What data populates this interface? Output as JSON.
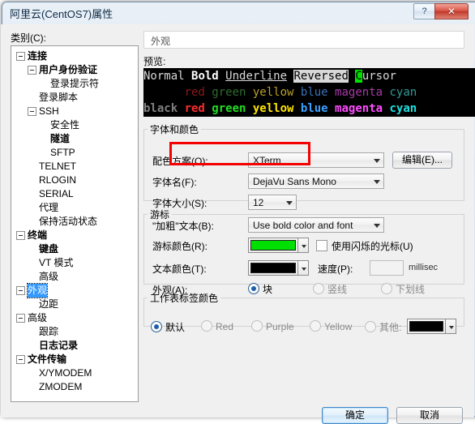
{
  "window": {
    "title": "阿里云(CentOS7)属性",
    "help_button": "?",
    "close_button": "✕"
  },
  "left": {
    "category_label": "类别(C):",
    "tree": [
      {
        "label": "连接",
        "level": 0,
        "bold": true,
        "expander": true
      },
      {
        "label": "用户身份验证",
        "level": 1,
        "bold": true,
        "expander": true
      },
      {
        "label": "登录提示符",
        "level": 2,
        "bold": false,
        "expander": false
      },
      {
        "label": "登录脚本",
        "level": 1,
        "bold": false,
        "expander": false
      },
      {
        "label": "SSH",
        "level": 1,
        "bold": false,
        "expander": true
      },
      {
        "label": "安全性",
        "level": 2,
        "bold": false,
        "expander": false
      },
      {
        "label": "隧道",
        "level": 2,
        "bold": true,
        "expander": false
      },
      {
        "label": "SFTP",
        "level": 2,
        "bold": false,
        "expander": false
      },
      {
        "label": "TELNET",
        "level": 1,
        "bold": false,
        "expander": false
      },
      {
        "label": "RLOGIN",
        "level": 1,
        "bold": false,
        "expander": false
      },
      {
        "label": "SERIAL",
        "level": 1,
        "bold": false,
        "expander": false
      },
      {
        "label": "代理",
        "level": 1,
        "bold": false,
        "expander": false
      },
      {
        "label": "保持活动状态",
        "level": 1,
        "bold": false,
        "expander": false
      },
      {
        "label": "终端",
        "level": 0,
        "bold": true,
        "expander": true
      },
      {
        "label": "键盘",
        "level": 1,
        "bold": true,
        "expander": false
      },
      {
        "label": "VT 模式",
        "level": 1,
        "bold": false,
        "expander": false
      },
      {
        "label": "高级",
        "level": 1,
        "bold": false,
        "expander": false
      },
      {
        "label": "外观",
        "level": 0,
        "bold": false,
        "expander": true,
        "selected": true
      },
      {
        "label": "边距",
        "level": 1,
        "bold": false,
        "expander": false
      },
      {
        "label": "高级",
        "level": 0,
        "bold": false,
        "expander": true
      },
      {
        "label": "跟踪",
        "level": 1,
        "bold": false,
        "expander": false
      },
      {
        "label": "日志记录",
        "level": 1,
        "bold": true,
        "expander": false
      },
      {
        "label": "文件传输",
        "level": 0,
        "bold": true,
        "expander": true
      },
      {
        "label": "X/YMODEM",
        "level": 1,
        "bold": false,
        "expander": false
      },
      {
        "label": "ZMODEM",
        "level": 1,
        "bold": false,
        "expander": false
      }
    ]
  },
  "right": {
    "tab_header": "外观",
    "preview_label": "预览:",
    "preview": {
      "line1": [
        {
          "text": "Normal ",
          "style": "normal"
        },
        {
          "text": "Bold",
          "style": "bold"
        },
        {
          "text": " ",
          "style": "normal"
        },
        {
          "text": "Underline",
          "style": "underline"
        },
        {
          "text": " ",
          "style": "normal"
        },
        {
          "text": "Reversed",
          "style": "reversed"
        },
        {
          "text": " ",
          "style": "normal"
        },
        {
          "text": "C",
          "style": "cursor"
        },
        {
          "text": "ursor",
          "style": "normal"
        }
      ],
      "line2": [
        {
          "text": "      ",
          "color": "#000000"
        },
        {
          "text": "red ",
          "color": "#8b1a1a"
        },
        {
          "text": "green ",
          "color": "#2e6b2e"
        },
        {
          "text": "yellow ",
          "color": "#b8a12a"
        },
        {
          "text": "blue ",
          "color": "#3a73b8"
        },
        {
          "text": "magenta ",
          "color": "#a83aa8"
        },
        {
          "text": "cyan",
          "color": "#2f9a9a"
        }
      ],
      "line3": [
        {
          "text": "black ",
          "color": "#808080"
        },
        {
          "text": "red ",
          "color": "#ff2b2b"
        },
        {
          "text": "green ",
          "color": "#22dd22"
        },
        {
          "text": "yellow ",
          "color": "#ffe600"
        },
        {
          "text": "blue ",
          "color": "#3aa0ff"
        },
        {
          "text": "magenta ",
          "color": "#ff4cff"
        },
        {
          "text": "cyan",
          "color": "#1ee0e0"
        }
      ]
    },
    "font_group": {
      "legend": "字体和颜色",
      "scheme_label": "配色方案(O):",
      "scheme_value": "XTerm",
      "edit_button": "编辑(E)...",
      "fontname_label": "字体名(F):",
      "fontname_value": "DejaVu Sans Mono",
      "fontsize_label": "字体大小(S):",
      "fontsize_value": "12",
      "bold_label": "\"加粗\"文本(B):",
      "bold_value": "Use bold color and font"
    },
    "cursor_group": {
      "legend": "游标",
      "cursor_color_label": "游标颜色(R):",
      "cursor_color_value": "#00e000",
      "text_color_label": "文本颜色(T):",
      "text_color_value": "#000000",
      "appearance_label": "外观(A):",
      "appearance_options": [
        "块",
        "竖线",
        "下划线"
      ],
      "appearance_selected": "块",
      "blink_label": "使用闪烁的光标(U)",
      "blink_checked": false,
      "speed_label": "速度(P):",
      "speed_value": "",
      "speed_unit": "millisec"
    },
    "tab_group": {
      "legend": "工作表标签颜色",
      "options": [
        "默认",
        "Red",
        "Purple",
        "Yellow",
        "其他:"
      ],
      "selected": "默认",
      "other_color": "#000000"
    }
  },
  "footer": {
    "ok": "确定",
    "cancel": "取消"
  }
}
